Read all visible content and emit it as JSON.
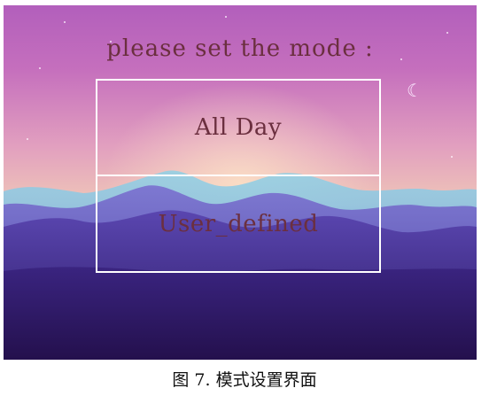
{
  "screen": {
    "prompt": "please set the mode :",
    "modes": [
      {
        "label": "All Day"
      },
      {
        "label": "User_defined"
      }
    ],
    "moon_icon": "crescent-moon",
    "colors": {
      "text": "#6b2f3f",
      "border": "#ffffff"
    }
  },
  "caption": "图 7. 模式设置界面"
}
